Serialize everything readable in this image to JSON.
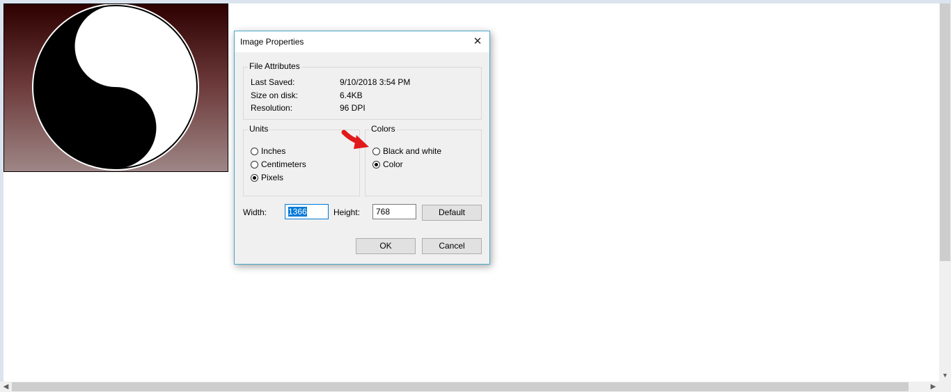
{
  "dialog": {
    "title": "Image Properties",
    "close_glyph": "✕",
    "file_attributes": {
      "legend": "File Attributes",
      "rows": [
        {
          "label": "Last Saved:",
          "value": "9/10/2018 3:54 PM"
        },
        {
          "label": "Size on disk:",
          "value": "6.4KB"
        },
        {
          "label": "Resolution:",
          "value": "96 DPI"
        }
      ]
    },
    "units": {
      "legend": "Units",
      "options": [
        {
          "label": "Inches",
          "checked": false
        },
        {
          "label": "Centimeters",
          "checked": false
        },
        {
          "label": "Pixels",
          "checked": true
        }
      ]
    },
    "colors": {
      "legend": "Colors",
      "options": [
        {
          "label": "Black and white",
          "checked": false
        },
        {
          "label": "Color",
          "checked": true
        }
      ]
    },
    "width": {
      "label": "Width:",
      "value": "1366"
    },
    "height": {
      "label": "Height:",
      "value": "768"
    },
    "default_button": "Default",
    "ok_button": "OK",
    "cancel_button": "Cancel"
  },
  "canvas": {
    "image_icon": "yin-yang-icon"
  },
  "colors": {
    "accent": "#0078d7",
    "dialog_border": "#47a8c7",
    "annotation_arrow": "#e0191b"
  }
}
